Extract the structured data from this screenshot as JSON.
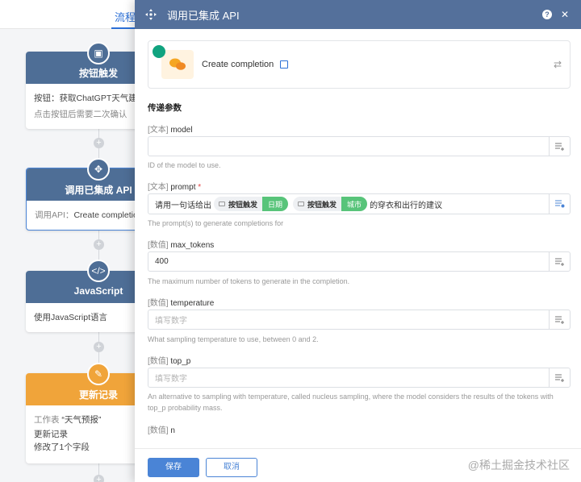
{
  "canvas": {
    "tab_label": "流程",
    "nodes": [
      {
        "title": "按钮触发",
        "line1": "按钮：获取ChatGPT天气建议",
        "line2": "点击按钮后需要二次确认"
      },
      {
        "title": "调用已集成 API",
        "line1_label": "调用API：",
        "line1_value": "Create completion"
      },
      {
        "title": "JavaScript",
        "line1": "使用JavaScript语言"
      },
      {
        "title": "更新记录",
        "line1_label": "工作表",
        "line1_value": "“天气预报”",
        "line2": "更新记录",
        "line3": "修改了1个字段"
      }
    ]
  },
  "panel": {
    "title": "调用已集成 API",
    "api_name": "Create completion",
    "section_title": "传递参数",
    "fields": [
      {
        "tag": "[文本]",
        "name": "model",
        "required": "",
        "value": "",
        "placeholder": "",
        "help": "ID of the model to use."
      },
      {
        "tag": "[文本]",
        "name": "prompt",
        "required": "*",
        "help": "The prompt(s) to generate completions for",
        "prompt_parts": {
          "prefix": "请用一句话给出",
          "chip1_node": "按钮触发",
          "chip1_field": "日期",
          "chip2_node": "按钮触发",
          "chip2_field": "城市",
          "suffix": "的穿衣和出行的建议"
        }
      },
      {
        "tag": "[数值]",
        "name": "max_tokens",
        "required": "",
        "value": "400",
        "placeholder": "",
        "help": "The maximum number of tokens to generate in the completion."
      },
      {
        "tag": "[数值]",
        "name": "temperature",
        "required": "",
        "value": "",
        "placeholder": "填写数字",
        "help": "What sampling temperature to use, between 0 and 2."
      },
      {
        "tag": "[数值]",
        "name": "top_p",
        "required": "",
        "value": "",
        "placeholder": "填写数字",
        "help": "An alternative to sampling with temperature, called nucleus sampling, where the model considers the results of the tokens with top_p probability mass."
      },
      {
        "tag": "[数值]",
        "name": "n",
        "required": ""
      }
    ],
    "save_label": "保存",
    "cancel_label": "取消",
    "watermark": "@稀土掘金技术社区"
  },
  "colors": {
    "header": "#54709b",
    "accent": "#4a84d6",
    "chip_green": "#58c47a",
    "node_orange": "#f0a43a"
  }
}
